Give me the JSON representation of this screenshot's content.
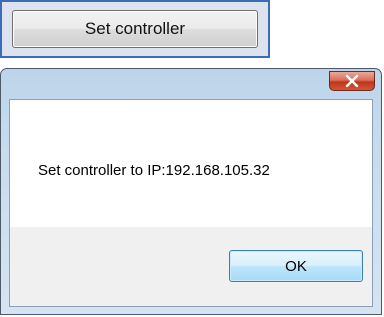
{
  "set_controller_button": {
    "label": "Set controller"
  },
  "dialog": {
    "title": "",
    "close_icon": "close-x-icon",
    "message": "Set controller to IP:192.168.105.32",
    "ok_label": "OK"
  },
  "colors": {
    "focus_frame": "#3b6db6",
    "close_button": "#c2351b",
    "ok_button_border": "#3c7fb1",
    "window_frame": "#c7dbee"
  }
}
